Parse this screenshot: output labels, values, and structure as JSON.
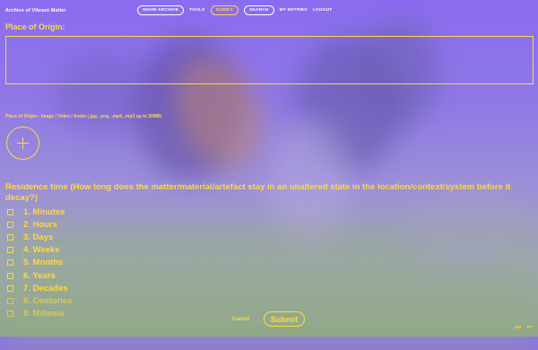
{
  "header": {
    "brand": "Archive of Vibrant Matter",
    "nav": [
      {
        "label": "SHOW ARCHIVE"
      },
      {
        "label": "TOOLS"
      },
      {
        "label": "SUBMIT"
      },
      {
        "label": "SEARCH"
      },
      {
        "label": "MY ENTRIES"
      },
      {
        "label": "LOGOUT"
      }
    ]
  },
  "form": {
    "place_label": "Place of Origin:",
    "place_value": "",
    "media_label": "Place of Origin - Image / Video / Audio (.jpg, .png, .mp4, .mp3 up to 30MB)",
    "residence_label": "Residence time (How long does the matter/material/artefact stay in an unaltered state in the location/context/system before it decay?)",
    "options": [
      {
        "label": "1. Minutes"
      },
      {
        "label": "2. Hours"
      },
      {
        "label": "3. Days"
      },
      {
        "label": "4. Weeks"
      },
      {
        "label": "5. Months"
      },
      {
        "label": "6. Years"
      },
      {
        "label": "7. Decades"
      },
      {
        "label": "8. Centuries"
      },
      {
        "label": "9. Millenia"
      }
    ]
  },
  "footer": {
    "cancel": "Cancel",
    "submit": "Submit",
    "lang_en": "EN",
    "lang_pt": "PT"
  },
  "colors": {
    "accent": "#ffd93d",
    "background": "#8f78e6"
  },
  "icons": {
    "add": "plus-icon"
  }
}
